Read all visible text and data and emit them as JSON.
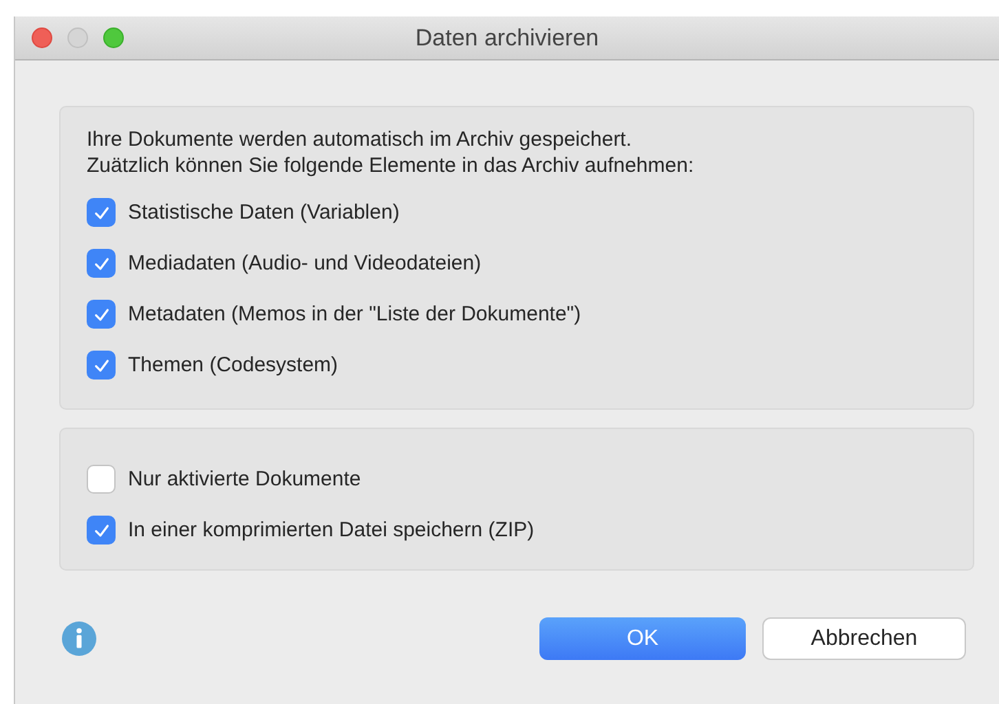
{
  "window": {
    "title": "Daten archivieren"
  },
  "intro": [
    "Ihre Dokumente werden automatisch im Archiv gespeichert.",
    "Zuätzlich können Sie folgende Elemente in das Archiv aufnehmen:"
  ],
  "elements": [
    {
      "label": "Statistische Daten (Variablen)",
      "checked": true
    },
    {
      "label": "Mediadaten (Audio- und Videodateien)",
      "checked": true
    },
    {
      "label": "Metadaten (Memos in der \"Liste der Dokumente\")",
      "checked": true
    },
    {
      "label": "Themen (Codesystem)",
      "checked": true
    }
  ],
  "options": [
    {
      "label": "Nur aktivierte Dokumente",
      "checked": false
    },
    {
      "label": "In einer komprimierten Datei speichern (ZIP)",
      "checked": true
    }
  ],
  "buttons": [
    {
      "label": "OK",
      "kind": "primary"
    },
    {
      "label": "Abbrechen",
      "kind": "secondary"
    }
  ]
}
